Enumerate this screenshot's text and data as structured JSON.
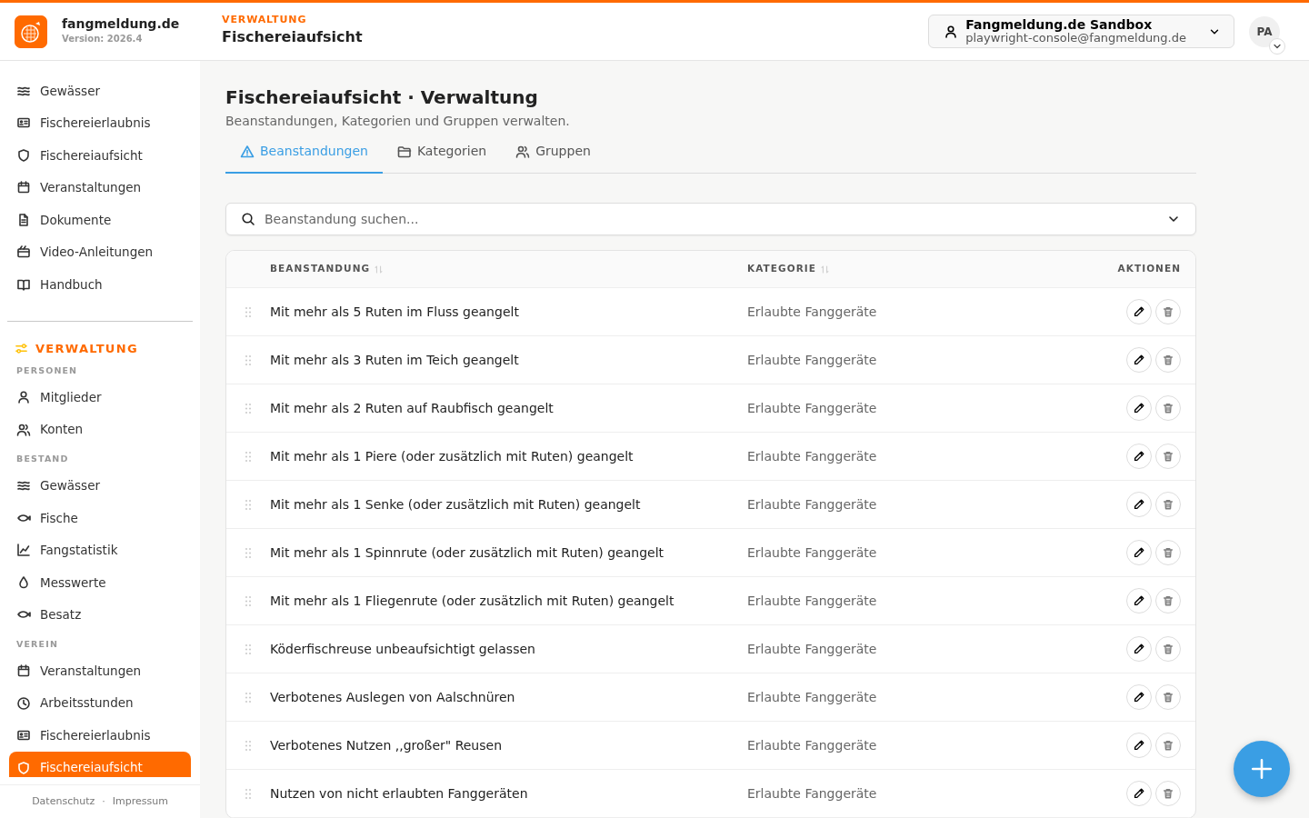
{
  "brand": {
    "name": "fangmeldung.de",
    "version": "Version: 2026.4"
  },
  "header": {
    "section": "VERWALTUNG",
    "title": "Fischereiaufsicht"
  },
  "account": {
    "name": "Fangmeldung.de Sandbox",
    "email": "playwright-console@fangmeldung.de",
    "initials": "PA"
  },
  "sidebar": {
    "top_items": [
      {
        "label": "Gewässer",
        "selected": false
      },
      {
        "label": "Fischereierlaubnis",
        "selected": false
      },
      {
        "label": "Fischereiaufsicht",
        "selected": false
      },
      {
        "label": "Veranstaltungen",
        "selected": false
      },
      {
        "label": "Dokumente",
        "selected": false
      },
      {
        "label": "Video-Anleitungen",
        "selected": false
      },
      {
        "label": "Handbuch",
        "selected": false
      }
    ],
    "admin_title": "VERWALTUNG",
    "groups": [
      {
        "title": "PERSONEN",
        "items": [
          {
            "label": "Mitglieder",
            "selected": false
          },
          {
            "label": "Konten",
            "selected": false
          }
        ]
      },
      {
        "title": "BESTAND",
        "items": [
          {
            "label": "Gewässer",
            "selected": false
          },
          {
            "label": "Fische",
            "selected": false
          },
          {
            "label": "Fangstatistik",
            "selected": false
          },
          {
            "label": "Messwerte",
            "selected": false
          },
          {
            "label": "Besatz",
            "selected": false
          }
        ]
      },
      {
        "title": "VEREIN",
        "items": [
          {
            "label": "Veranstaltungen",
            "selected": false
          },
          {
            "label": "Arbeitsstunden",
            "selected": false
          },
          {
            "label": "Fischereierlaubnis",
            "selected": false
          },
          {
            "label": "Fischereiaufsicht",
            "selected": true
          }
        ]
      }
    ],
    "footer_links": [
      "Datenschutz",
      "Impressum"
    ],
    "footer_separator": "·"
  },
  "page": {
    "title": "Fischereiaufsicht · Verwaltung",
    "subtitle": "Beanstandungen, Kategorien und Gruppen verwalten."
  },
  "tabs": [
    {
      "label": "Beanstandungen",
      "selected": true
    },
    {
      "label": "Kategorien",
      "selected": false
    },
    {
      "label": "Gruppen",
      "selected": false
    }
  ],
  "search": {
    "placeholder": "Beanstandung suchen..."
  },
  "table": {
    "columns": [
      "BEANSTANDUNG",
      "KATEGORIE",
      "AKTIONEN"
    ],
    "rows": [
      {
        "name": "Mit mehr als 5 Ruten im Fluss geangelt",
        "category": "Erlaubte Fanggeräte"
      },
      {
        "name": "Mit mehr als 3 Ruten im Teich geangelt",
        "category": "Erlaubte Fanggeräte"
      },
      {
        "name": "Mit mehr als 2 Ruten auf Raubfisch geangelt",
        "category": "Erlaubte Fanggeräte"
      },
      {
        "name": "Mit mehr als 1 Piere (oder zusätzlich mit Ruten) geangelt",
        "category": "Erlaubte Fanggeräte"
      },
      {
        "name": "Mit mehr als 1 Senke (oder zusätzlich mit Ruten) geangelt",
        "category": "Erlaubte Fanggeräte"
      },
      {
        "name": "Mit mehr als 1 Spinnrute (oder zusätzlich mit Ruten) geangelt",
        "category": "Erlaubte Fanggeräte"
      },
      {
        "name": "Mit mehr als 1 Fliegenrute (oder zusätzlich mit Ruten) geangelt",
        "category": "Erlaubte Fanggeräte"
      },
      {
        "name": "Köderfischreuse unbeaufsichtigt gelassen",
        "category": "Erlaubte Fanggeräte"
      },
      {
        "name": "Verbotenes Auslegen von Aalschnüren",
        "category": "Erlaubte Fanggeräte"
      },
      {
        "name": "Verbotenes Nutzen ,,großer\" Reusen",
        "category": "Erlaubte Fanggeräte"
      },
      {
        "name": "Nutzen von nicht erlaubten Fanggeräten",
        "category": "Erlaubte Fanggeräte"
      }
    ]
  }
}
